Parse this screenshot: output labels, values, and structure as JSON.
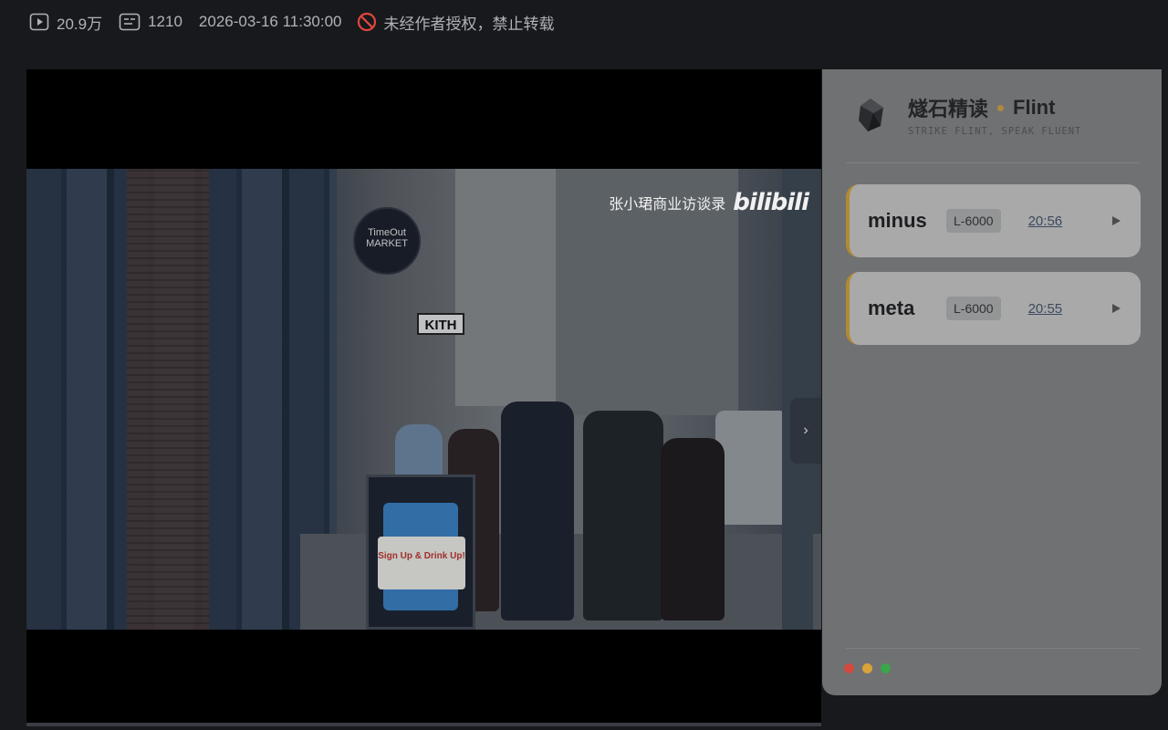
{
  "topbar": {
    "views": "20.9万",
    "danmaku": "1210",
    "datetime": "2026-03-16 11:30:00",
    "copyright_notice": "未经作者授权，禁止转载"
  },
  "video": {
    "watermark_text": "张小珺商业访谈录",
    "watermark_logo": "bilibili",
    "sign_market": "TimeOut MARKET",
    "sign_kith": "KITH",
    "board_text": "Sign Up & Drink Up!"
  },
  "panel": {
    "brand_cn": "燧石精读",
    "brand_en": "Flint",
    "tagline": "STRIKE FLINT, SPEAK FLUENT",
    "cards": [
      {
        "word": "minus",
        "level": "L-6000",
        "time": "20:56"
      },
      {
        "word": "meta",
        "level": "L-6000",
        "time": "20:55"
      }
    ],
    "lights": [
      "#d24a3f",
      "#d9a33a",
      "#3aa64a"
    ]
  },
  "colors": {
    "accent": "#b28a32",
    "panel_bg": "#707172",
    "card_bg": "#a9a9aa",
    "warn_red": "#e0463c"
  },
  "icons": {
    "views": "play-box-icon",
    "danmaku": "danmaku-icon",
    "copyright": "no-entry-icon",
    "collapse": "chevron-right-icon",
    "card_action": "play-triangle-icon"
  }
}
